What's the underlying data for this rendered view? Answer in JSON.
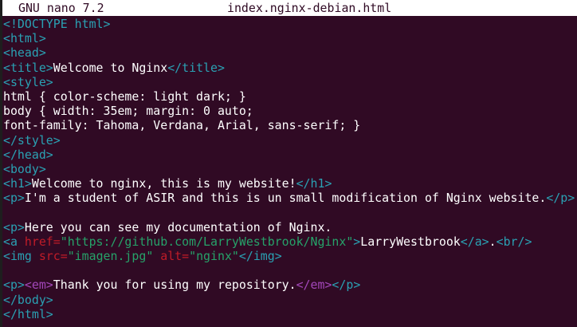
{
  "titlebar": {
    "app": "GNU nano 7.2",
    "file": "index.nginx-debian.html"
  },
  "colors": {
    "background": "#300a24",
    "tag": "#2aa1b3",
    "text": "#ffffff",
    "attr": "#c01c28",
    "string": "#26a269",
    "em": "#a347ba"
  },
  "lines": [
    [
      {
        "k": "tag",
        "t": "<!DOCTYPE html>"
      }
    ],
    [
      {
        "k": "tag",
        "t": "<html>"
      }
    ],
    [
      {
        "k": "tag",
        "t": "<head>"
      }
    ],
    [
      {
        "k": "tag",
        "t": "<title>"
      },
      {
        "k": "text",
        "t": "Welcome to Nginx"
      },
      {
        "k": "tag",
        "t": "</title>"
      }
    ],
    [
      {
        "k": "tag",
        "t": "<style>"
      }
    ],
    [
      {
        "k": "text",
        "t": "html { color-scheme: light dark; }"
      }
    ],
    [
      {
        "k": "text",
        "t": "body { width: 35em; margin: 0 auto;"
      }
    ],
    [
      {
        "k": "text",
        "t": "font-family: Tahoma, Verdana, Arial, sans-serif; }"
      }
    ],
    [
      {
        "k": "tag",
        "t": "</style>"
      }
    ],
    [
      {
        "k": "tag",
        "t": "</head>"
      }
    ],
    [
      {
        "k": "tag",
        "t": "<body>"
      }
    ],
    [
      {
        "k": "tag",
        "t": "<h1>"
      },
      {
        "k": "text",
        "t": "Welcome to nginx, this is my website!"
      },
      {
        "k": "tag",
        "t": "</h1>"
      }
    ],
    [
      {
        "k": "tag",
        "t": "<p>"
      },
      {
        "k": "text",
        "t": "I'm a student of ASIR and this is un small modification of Nginx website."
      },
      {
        "k": "tag",
        "t": "</p>"
      }
    ],
    [],
    [
      {
        "k": "tag",
        "t": "<p>"
      },
      {
        "k": "text",
        "t": "Here you can see my documentation of Nginx."
      }
    ],
    [
      {
        "k": "tag",
        "t": "<a "
      },
      {
        "k": "attr",
        "t": "href="
      },
      {
        "k": "str",
        "t": "\"https://github.com/LarryWestbrook/Nginx\""
      },
      {
        "k": "tag",
        "t": ">"
      },
      {
        "k": "text",
        "t": "LarryWestbrook"
      },
      {
        "k": "tag",
        "t": "</a>"
      },
      {
        "k": "text",
        "t": "."
      },
      {
        "k": "tag",
        "t": "<br/>"
      }
    ],
    [
      {
        "k": "tag",
        "t": "<img "
      },
      {
        "k": "attr",
        "t": "src="
      },
      {
        "k": "str",
        "t": "\"imagen.jpg\" "
      },
      {
        "k": "attr",
        "t": "alt="
      },
      {
        "k": "str",
        "t": "\"nginx\""
      },
      {
        "k": "tag",
        "t": "</img>"
      }
    ],
    [],
    [
      {
        "k": "tag",
        "t": "<p>"
      },
      {
        "k": "em",
        "t": "<em>"
      },
      {
        "k": "text",
        "t": "Thank you for using my repository."
      },
      {
        "k": "em",
        "t": "</em>"
      },
      {
        "k": "tag",
        "t": "</p>"
      }
    ],
    [
      {
        "k": "tag",
        "t": "</body>"
      }
    ],
    [
      {
        "k": "tag",
        "t": "</html>"
      }
    ]
  ]
}
